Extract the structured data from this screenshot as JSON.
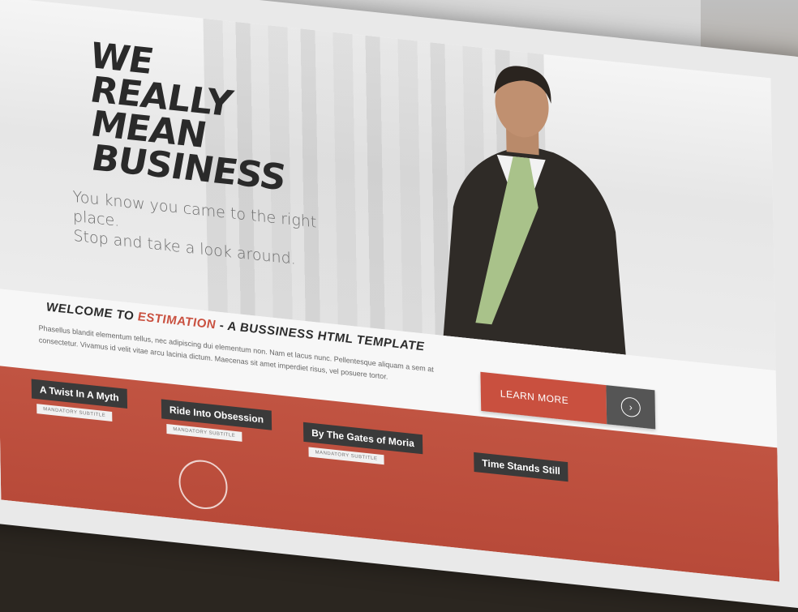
{
  "hero": {
    "headline": [
      "WE",
      "REALLY",
      "MEAN",
      "BUSINESS"
    ],
    "tagline": [
      "You know you came to the right place.",
      "Stop and take a look around."
    ]
  },
  "welcome": {
    "prefix": "WELCOME TO ",
    "brand": "ESTIMATION",
    "suffix": " - A BUSSINESS HTML TEMPLATE",
    "text": "Phasellus blandit elementum tellus, nec adipiscing dui elementum non. Nam et lacus nunc. Pellentesque aliquam a sem at consectetur. Vivamus id velit vitae arcu lacinia dictum. Maecenas sit amet imperdiet risus, vel posuere tortor."
  },
  "cta": {
    "label": "LEARN MORE",
    "arrow_icon": "chevron-right-icon"
  },
  "features": [
    {
      "title": "A Twist In A Myth",
      "subtitle": "MANDATORY SUBTITLE"
    },
    {
      "title": "Ride Into Obsession",
      "subtitle": "MANDATORY SUBTITLE"
    },
    {
      "title": "By The Gates of Moria",
      "subtitle": "MANDATORY SUBTITLE"
    },
    {
      "title": "Time Stands Still",
      "subtitle": ""
    }
  ],
  "colors": {
    "accent": "#c9503f",
    "dark": "#3a3a3a",
    "text": "#2b2b2b"
  }
}
